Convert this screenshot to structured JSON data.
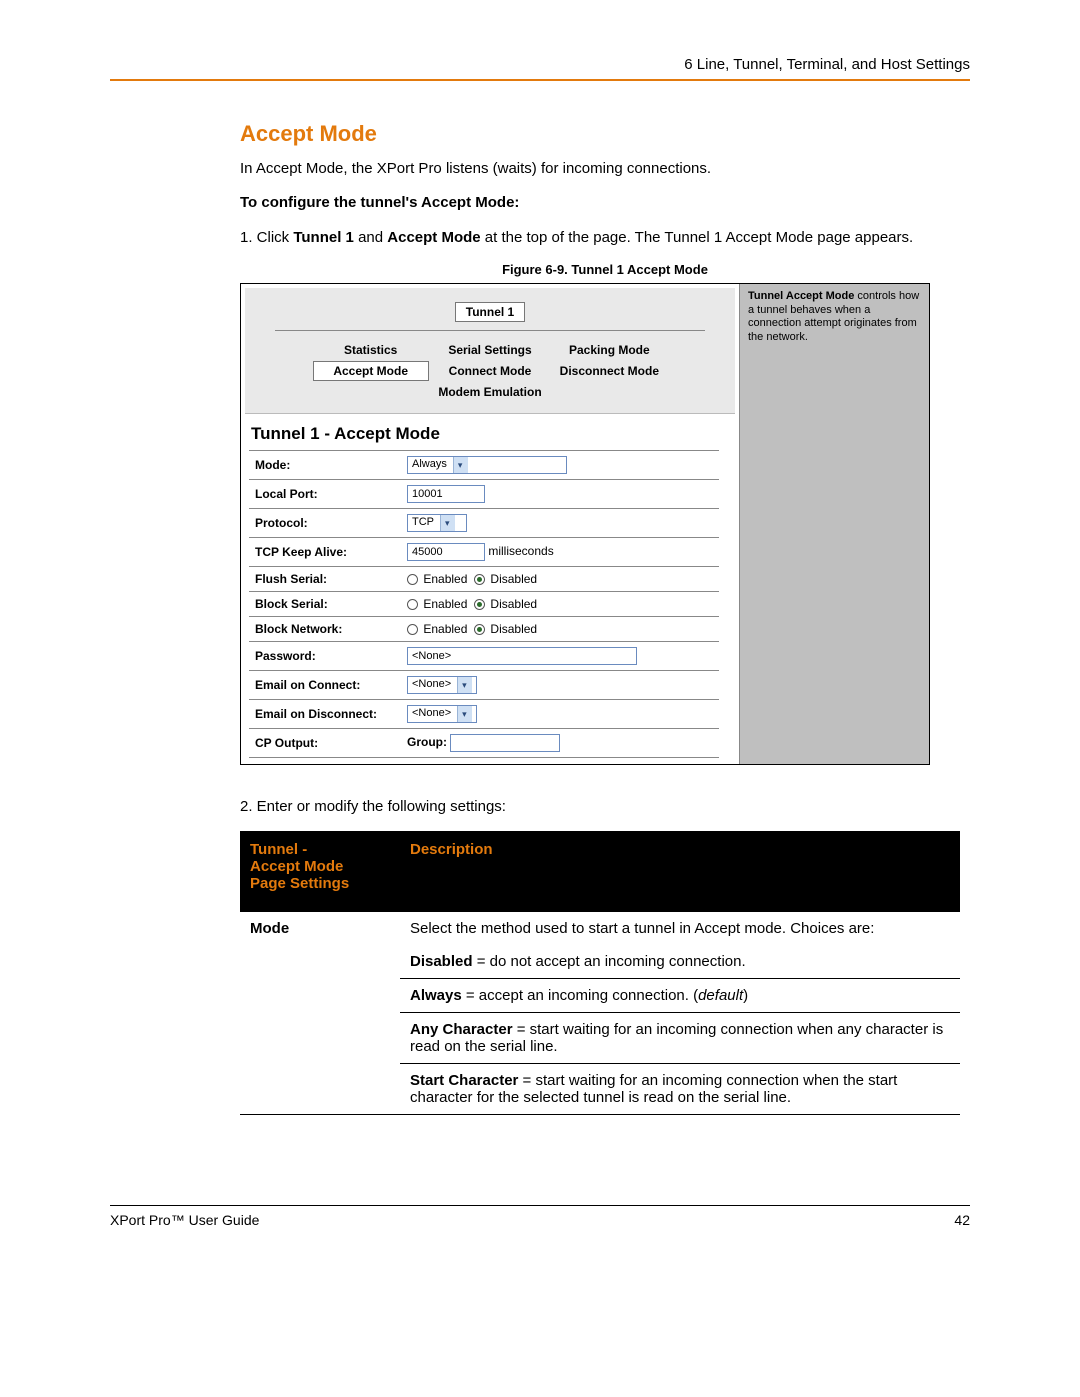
{
  "header": {
    "chapter": "6 Line, Tunnel, Terminal, and Host Settings"
  },
  "section": {
    "title": "Accept Mode",
    "intro": "In Accept Mode, the XPort Pro listens (waits) for incoming connections.",
    "config_heading": "To configure the tunnel's Accept Mode:",
    "step1_a": "1.   Click ",
    "step1_b": "Tunnel 1",
    "step1_c": " and ",
    "step1_d": "Accept Mode",
    "step1_e": " at the top of the page. The Tunnel 1 Accept Mode page appears.",
    "step2": "2.   Enter or modify the following settings:"
  },
  "figure": {
    "caption": "Figure 6-9. Tunnel 1 Accept Mode",
    "main_tab": "Tunnel 1",
    "tabs_row1": [
      "Statistics",
      "Serial Settings",
      "Packing Mode"
    ],
    "tabs_row2": [
      "Accept Mode",
      "Connect Mode",
      "Disconnect Mode"
    ],
    "tabs_row3_center": "Modem Emulation",
    "panel_title": "Tunnel 1 - Accept Mode",
    "rows": {
      "mode": {
        "label": "Mode:",
        "value": "Always"
      },
      "local_port": {
        "label": "Local Port:",
        "value": "10001"
      },
      "protocol": {
        "label": "Protocol:",
        "value": "TCP"
      },
      "tcp_keep": {
        "label": "TCP Keep Alive:",
        "value": "45000",
        "unit": "milliseconds"
      },
      "flush_serial": {
        "label": "Flush Serial:",
        "opt1": "Enabled",
        "opt2": "Disabled"
      },
      "block_serial": {
        "label": "Block Serial:",
        "opt1": "Enabled",
        "opt2": "Disabled"
      },
      "block_network": {
        "label": "Block Network:",
        "opt1": "Enabled",
        "opt2": "Disabled"
      },
      "password": {
        "label": "Password:",
        "value": "<None>"
      },
      "email_connect": {
        "label": "Email on Connect:",
        "value": "<None>"
      },
      "email_disconnect": {
        "label": "Email on Disconnect:",
        "value": "<None>"
      },
      "cp_output": {
        "label": "CP Output:",
        "group_label": "Group:"
      }
    },
    "help_title": "Tunnel Accept Mode",
    "help_text": " controls how a tunnel behaves when a connection attempt originates from the network."
  },
  "table": {
    "head1a": "Tunnel -",
    "head1b": "Accept Mode",
    "head1c": "Page Settings",
    "head2": "Description",
    "row_mode": {
      "key": "Mode",
      "intro": "Select the method used to start a tunnel in Accept mode. Choices are:",
      "disabled_k": "Disabled",
      "disabled_v": " = do not accept an incoming connection.",
      "always_k": "Always",
      "always_v": " = accept an incoming connection. (",
      "always_def": "default",
      "always_close": ")",
      "anychar_k": "Any Character",
      "anychar_v": " = start waiting for an incoming connection when any character is read on the serial line.",
      "startchar_k": "Start Character",
      "startchar_v": " = start waiting for an incoming connection when the start character for the selected tunnel is read on the serial line."
    }
  },
  "footer": {
    "left": "XPort Pro™ User Guide",
    "right": "42"
  }
}
